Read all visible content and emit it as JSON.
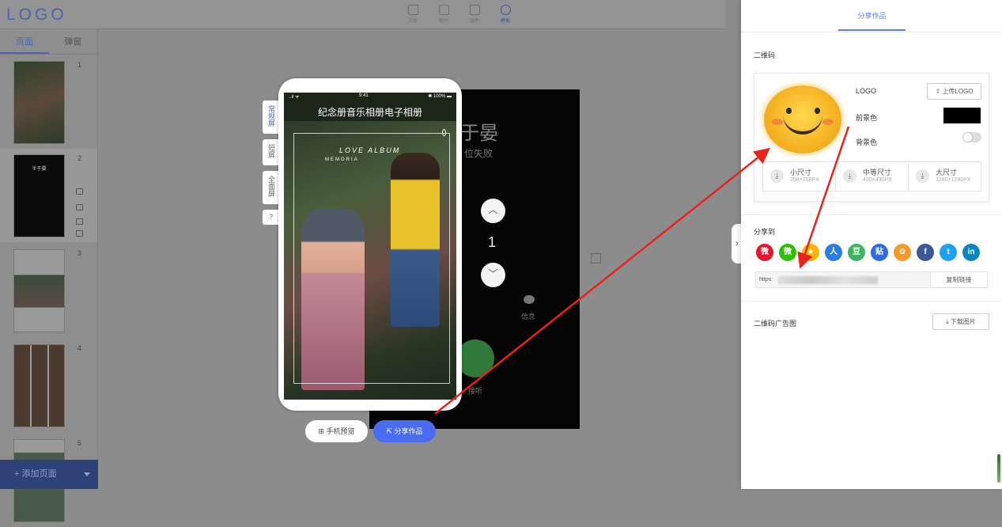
{
  "app": {
    "logo": "LOGO"
  },
  "toolbar": {
    "items": [
      {
        "label": "文本",
        "icon": "text-icon"
      },
      {
        "label": "图片",
        "icon": "image-icon"
      },
      {
        "label": "组件",
        "icon": "widget-icon"
      },
      {
        "label": "模板",
        "icon": "bulb-icon"
      }
    ]
  },
  "sidebar": {
    "tabs": [
      "页面",
      "弹窗"
    ],
    "active_tab": "页面",
    "pages": [
      "1",
      "2",
      "3",
      "4",
      "5"
    ],
    "page2_thumb_title": "半于晏",
    "add_page": "+ 添加页面"
  },
  "editor": {
    "side_tabs": [
      "常规屏",
      "短屏",
      "全面屏",
      "?"
    ],
    "active_side_tab": "常规屏",
    "status_left": "..ıl ᯤ",
    "status_time": "9:41",
    "status_right": "✱ 100% ▬",
    "phone_title": "纪念册音乐相册电子相册",
    "love_text": "LOVE ALBUM",
    "memoria_text": "MEMORIA",
    "bg_title": "于晏",
    "bg_subtitle": "位失败",
    "bg_message_label": "信息",
    "bg_answer_label": "接听",
    "page_number": "1",
    "preview_button": "手机预览",
    "share_button": "分享作品"
  },
  "panel": {
    "tab": "分享作品",
    "qr_section": "二维码",
    "logo_label": "LOGO",
    "upload_logo": "上传LOGO",
    "foreground_label": "前景色",
    "foreground_color": "#000000",
    "background_label": "背景色",
    "background_enabled": false,
    "sizes": [
      {
        "name": "小尺寸",
        "dim": "258×258PX"
      },
      {
        "name": "中等尺寸",
        "dim": "430×430PX"
      },
      {
        "name": "大尺寸",
        "dim": "1280×1280PX"
      }
    ],
    "share_to": "分享到",
    "social": [
      {
        "name": "weibo",
        "glyph": "微",
        "color": "#e6162d"
      },
      {
        "name": "wechat",
        "glyph": "微",
        "color": "#2dc100"
      },
      {
        "name": "qzone",
        "glyph": "★",
        "color": "#f6b600"
      },
      {
        "name": "renren",
        "glyph": "人",
        "color": "#2b7de1"
      },
      {
        "name": "douban",
        "glyph": "豆",
        "color": "#3fb45f"
      },
      {
        "name": "tieba",
        "glyph": "贴",
        "color": "#2e6be6"
      },
      {
        "name": "flower",
        "glyph": "✿",
        "color": "#f39a2b"
      },
      {
        "name": "facebook",
        "glyph": "f",
        "color": "#3b5998"
      },
      {
        "name": "twitter",
        "glyph": "t",
        "color": "#1da1f2"
      },
      {
        "name": "linkedin",
        "glyph": "in",
        "color": "#0a86c4"
      }
    ],
    "url_prefix": "https:",
    "copy_link": "复制链接",
    "qr_ad": "二维码广告图",
    "download_image": "下载图片"
  }
}
